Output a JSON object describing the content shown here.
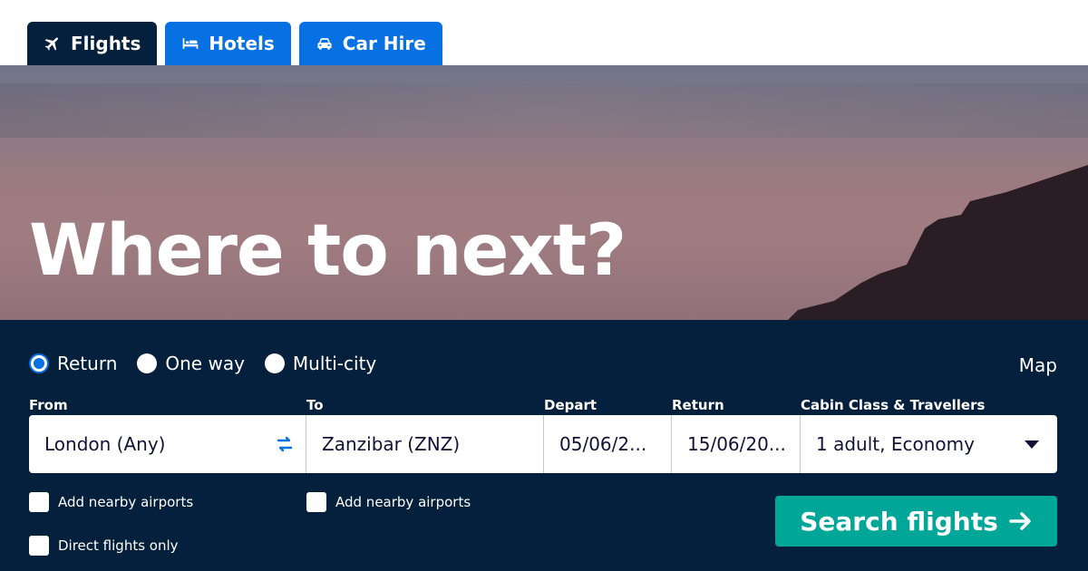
{
  "tabs": [
    {
      "label": "Flights",
      "icon": "plane-icon",
      "active": true
    },
    {
      "label": "Hotels",
      "icon": "bed-icon",
      "active": false
    },
    {
      "label": "Car Hire",
      "icon": "car-icon",
      "active": false
    }
  ],
  "hero": {
    "headline": "Where to next?"
  },
  "trip_type": {
    "options": [
      "Return",
      "One way",
      "Multi-city"
    ],
    "selected": "Return"
  },
  "map_link": "Map",
  "labels": {
    "from": "From",
    "to": "To",
    "depart": "Depart",
    "return": "Return",
    "cabin": "Cabin Class & Travellers"
  },
  "fields": {
    "from": "London (Any)",
    "to": "Zanzibar (ZNZ)",
    "depart": "05/06/2...",
    "return": "15/06/20...",
    "cabin": "1 adult, Economy"
  },
  "checkboxes": {
    "nearby_from": "Add nearby airports",
    "nearby_to": "Add nearby airports",
    "direct": "Direct flights only"
  },
  "search_button": "Search flights",
  "colors": {
    "navy": "#05203c",
    "blue": "#0770e3",
    "teal": "#00a698"
  }
}
